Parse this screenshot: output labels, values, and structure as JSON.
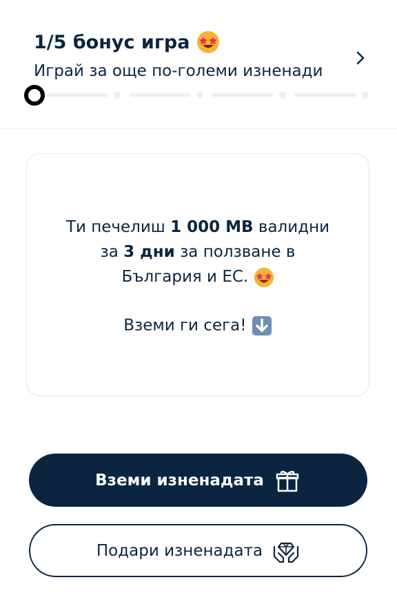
{
  "header": {
    "title": "1/5 бонус игра",
    "title_emoji": "star-struck-emoji",
    "subtitle": "Играй за още по-големи изненади",
    "chevron_icon": "chevron-right-icon",
    "progress": {
      "current": 1,
      "total": 5
    }
  },
  "card": {
    "message_part1": "Ти печелиш ",
    "message_amount": "1 000 MB",
    "message_part2": " валидни",
    "message_part3": "за ",
    "message_days": "3 дни",
    "message_part4": " за ползване в",
    "message_part5": "България и ЕС.",
    "message_emoji": "star-struck-emoji",
    "cta_text": "Вземи ги сега!",
    "cta_emoji": "down-arrow-emoji"
  },
  "actions": {
    "claim_label": "Вземи изненадата",
    "claim_icon": "gift-icon",
    "gift_label": "Подари изненадата",
    "gift_icon": "hands-diamond-icon"
  },
  "colors": {
    "primary": "#0b2540",
    "emoji_face": "#f7b433",
    "emoji_hearts": "#e8344e",
    "card_border": "#e3e6ea"
  }
}
